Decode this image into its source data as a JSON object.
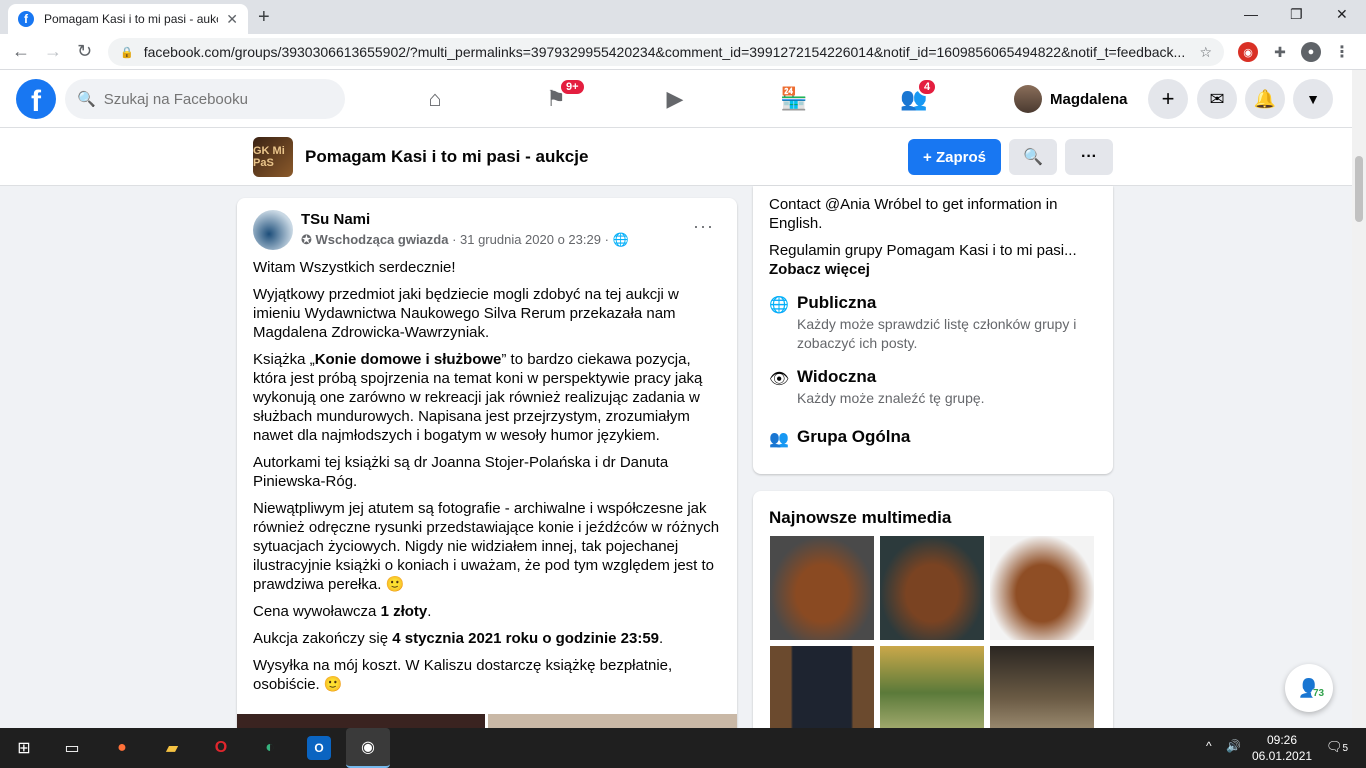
{
  "browser": {
    "tab_title": "Pomagam Kasi i to mi pasi - aukcje",
    "tab_favicon": "f",
    "url": "facebook.com/groups/3930306613655902/?multi_permalinks=3979329955420234&comment_id=3991272154226014&notif_id=1609856065494822&notif_t=feedback..."
  },
  "fb": {
    "search_placeholder": "Szukaj na Facebooku",
    "logo_letter": "f",
    "groups_badge": "9+",
    "notif_badge": "4",
    "profile_name": "Magdalena"
  },
  "group": {
    "thumb_text": "GK Mi PaS",
    "name": "Pomagam Kasi i to mi pasi - aukcje",
    "invite_label": "+ Zaproś",
    "more_label": "···"
  },
  "post": {
    "author": "TSu Nami",
    "badge": "Wschodząca gwiazda",
    "date": " · 31 grudnia 2020 o 23:29 · ",
    "more": "···",
    "p1": "Witam Wszystkich serdecznie!",
    "p2": "Wyjątkowy przedmiot jaki będziecie mogli zdobyć na tej aukcji w imieniu Wydawnictwa Naukowego Silva Rerum przekazała nam Magdalena Zdrowicka-Wawrzyniak.",
    "p3_pre": "Książka „",
    "p3_bold": "Konie domowe i służbowe",
    "p3_post": "” to bardzo ciekawa pozycja, która jest próbą spojrzenia na temat koni w perspektywie pracy jaką wykonują one zarówno w rekreacji jak również realizując zadania w służbach mundurowych. Napisana jest przejrzystym, zrozumiałym nawet dla najmłodszych i bogatym w wesoły humor językiem.",
    "p4": "Autorkami tej książki są dr Joanna Stojer-Polańska i dr Danuta Piniewska-Róg.",
    "p5": "Niewątpliwym jej atutem są fotografie - archiwalne i współczesne jak również odręczne rysunki przedstawiające konie i jeźdźców w różnych sytuacjach życiowych. Nigdy nie widziałem innej, tak pojechanej ilustracyjnie książki o koniach i uważam, że pod tym względem jest to prawdziwa perełka. 🙂",
    "p6_pre": "Cena wywoławcza ",
    "p6_bold": "1 złoty",
    "p6_post": ".",
    "p7_pre": "Aukcja zakończy się ",
    "p7_bold": "4 stycznia 2021 roku o godzinie 23:59",
    "p7_post": ".",
    "p8": "Wysyłka na mój koszt. W Kaliszu dostarczę książkę bezpłatnie, osobiście. 🙂"
  },
  "about": {
    "contact": "Contact @Ania Wróbel to get information in English.",
    "rules": "Regulamin grupy Pomagam Kasi i to mi pasi...",
    "see_more": "Zobacz więcej",
    "public_title": "Publiczna",
    "public_desc": "Każdy może sprawdzić listę członków grupy i zobaczyć ich posty.",
    "visible_title": "Widoczna",
    "visible_desc": "Każdy może znaleźć tę grupę.",
    "general_title": "Grupa Ogólna"
  },
  "media": {
    "title": "Najnowsze multimedia"
  },
  "chat": {
    "count": "73"
  },
  "taskbar": {
    "time": "09:26",
    "date": "06.01.2021",
    "notif_count": "5"
  },
  "colors": {
    "fb_blue": "#1877f2",
    "badge_red": "#e41e3f",
    "bg": "#f0f2f5"
  }
}
